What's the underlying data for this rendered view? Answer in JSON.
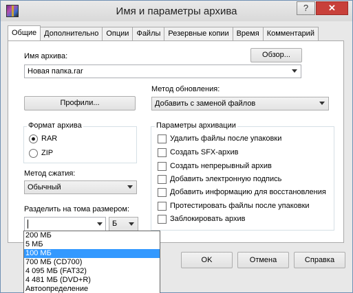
{
  "window": {
    "title": "Имя и параметры архива",
    "help_label": "?",
    "close_label": "✕"
  },
  "tabs": [
    {
      "label": "Общие",
      "active": true
    },
    {
      "label": "Дополнительно"
    },
    {
      "label": "Опции"
    },
    {
      "label": "Файлы"
    },
    {
      "label": "Резервные копии"
    },
    {
      "label": "Время"
    },
    {
      "label": "Комментарий"
    }
  ],
  "archive": {
    "name_label": "Имя архива:",
    "browse_label": "Обзор...",
    "name_value": "Новая папка.rar"
  },
  "update": {
    "label": "Метод обновления:",
    "value": "Добавить с заменой файлов"
  },
  "profiles_label": "Профили...",
  "format": {
    "title": "Формат архива",
    "options": [
      "RAR",
      "ZIP"
    ],
    "selected": "RAR"
  },
  "compression": {
    "label": "Метод сжатия:",
    "value": "Обычный"
  },
  "split": {
    "label": "Разделить на тома размером:",
    "value": "",
    "unit": "Б",
    "options": [
      "200 МБ",
      "5 МБ",
      "100 МБ",
      "700 МБ  (CD700)",
      "4 095 МБ  (FAT32)",
      "4 481 МБ  (DVD+R)",
      "Автоопределение"
    ],
    "highlighted": "100 МБ"
  },
  "params": {
    "title": "Параметры архивации",
    "options": [
      "Удалить файлы после упаковки",
      "Создать SFX-архив",
      "Создать непрерывный архив",
      "Добавить электронную подпись",
      "Добавить информацию для восстановления",
      "Протестировать файлы после упаковки",
      "Заблокировать архив"
    ]
  },
  "buttons": {
    "ok": "OK",
    "cancel": "Отмена",
    "help": "Справка"
  },
  "colors": {
    "selection": "#3399ff",
    "close": "#c8403a"
  }
}
